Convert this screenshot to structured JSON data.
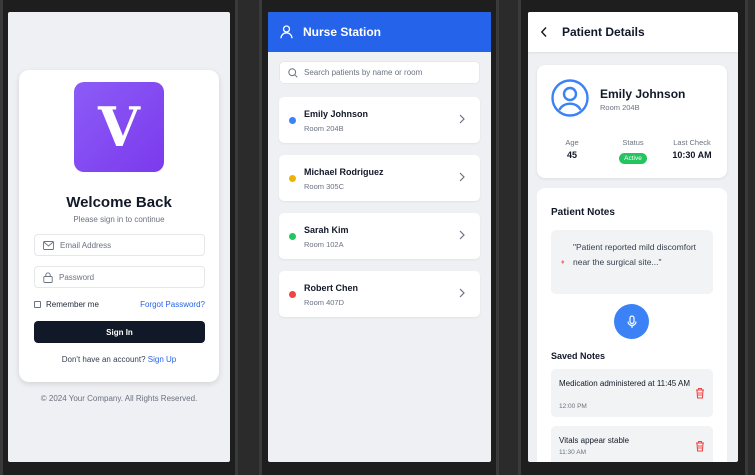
{
  "login": {
    "logo_letter": "V",
    "title": "Welcome Back",
    "subtitle": "Please sign in to continue",
    "email_placeholder": "Email Address",
    "password_placeholder": "Password",
    "remember_label": "Remember me",
    "forgot_label": "Forgot Password?",
    "signin_label": "Sign In",
    "no_account_text": "Don't have an account?",
    "signup_label": "Sign Up",
    "copyright": "© 2024 Your Company. All Rights Reserved.",
    "accent_color": "#7c3aed"
  },
  "station": {
    "title": "Nurse Station",
    "search_placeholder": "Search patients by name or room",
    "header_color": "#2563eb",
    "patients": [
      {
        "name": "Emily Johnson",
        "room": "Room 204B",
        "status_color": "#3b82f6"
      },
      {
        "name": "Michael Rodriguez",
        "room": "Room 305C",
        "status_color": "#eab308"
      },
      {
        "name": "Sarah Kim",
        "room": "Room 102A",
        "status_color": "#22c55e"
      },
      {
        "name": "Robert Chen",
        "room": "Room 407D",
        "status_color": "#ef4444"
      }
    ]
  },
  "details": {
    "title": "Patient Details",
    "patient_name": "Emily Johnson",
    "room": "Room 204B",
    "age_label": "Age",
    "age_value": "45",
    "status_label": "Status",
    "status_value": "Active",
    "last_check_label": "Last Check",
    "last_check_value": "10:30 AM",
    "notes_title": "Patient Notes",
    "quote": "\"Patient reported mild discomfort near the surgical site...\"",
    "saved_title": "Saved Notes",
    "saved_notes": [
      {
        "text": "Medication administered at 11:45 AM",
        "time": "12:00 PM"
      },
      {
        "text": "Vitals appear stable",
        "time": "11:30 AM"
      }
    ]
  }
}
